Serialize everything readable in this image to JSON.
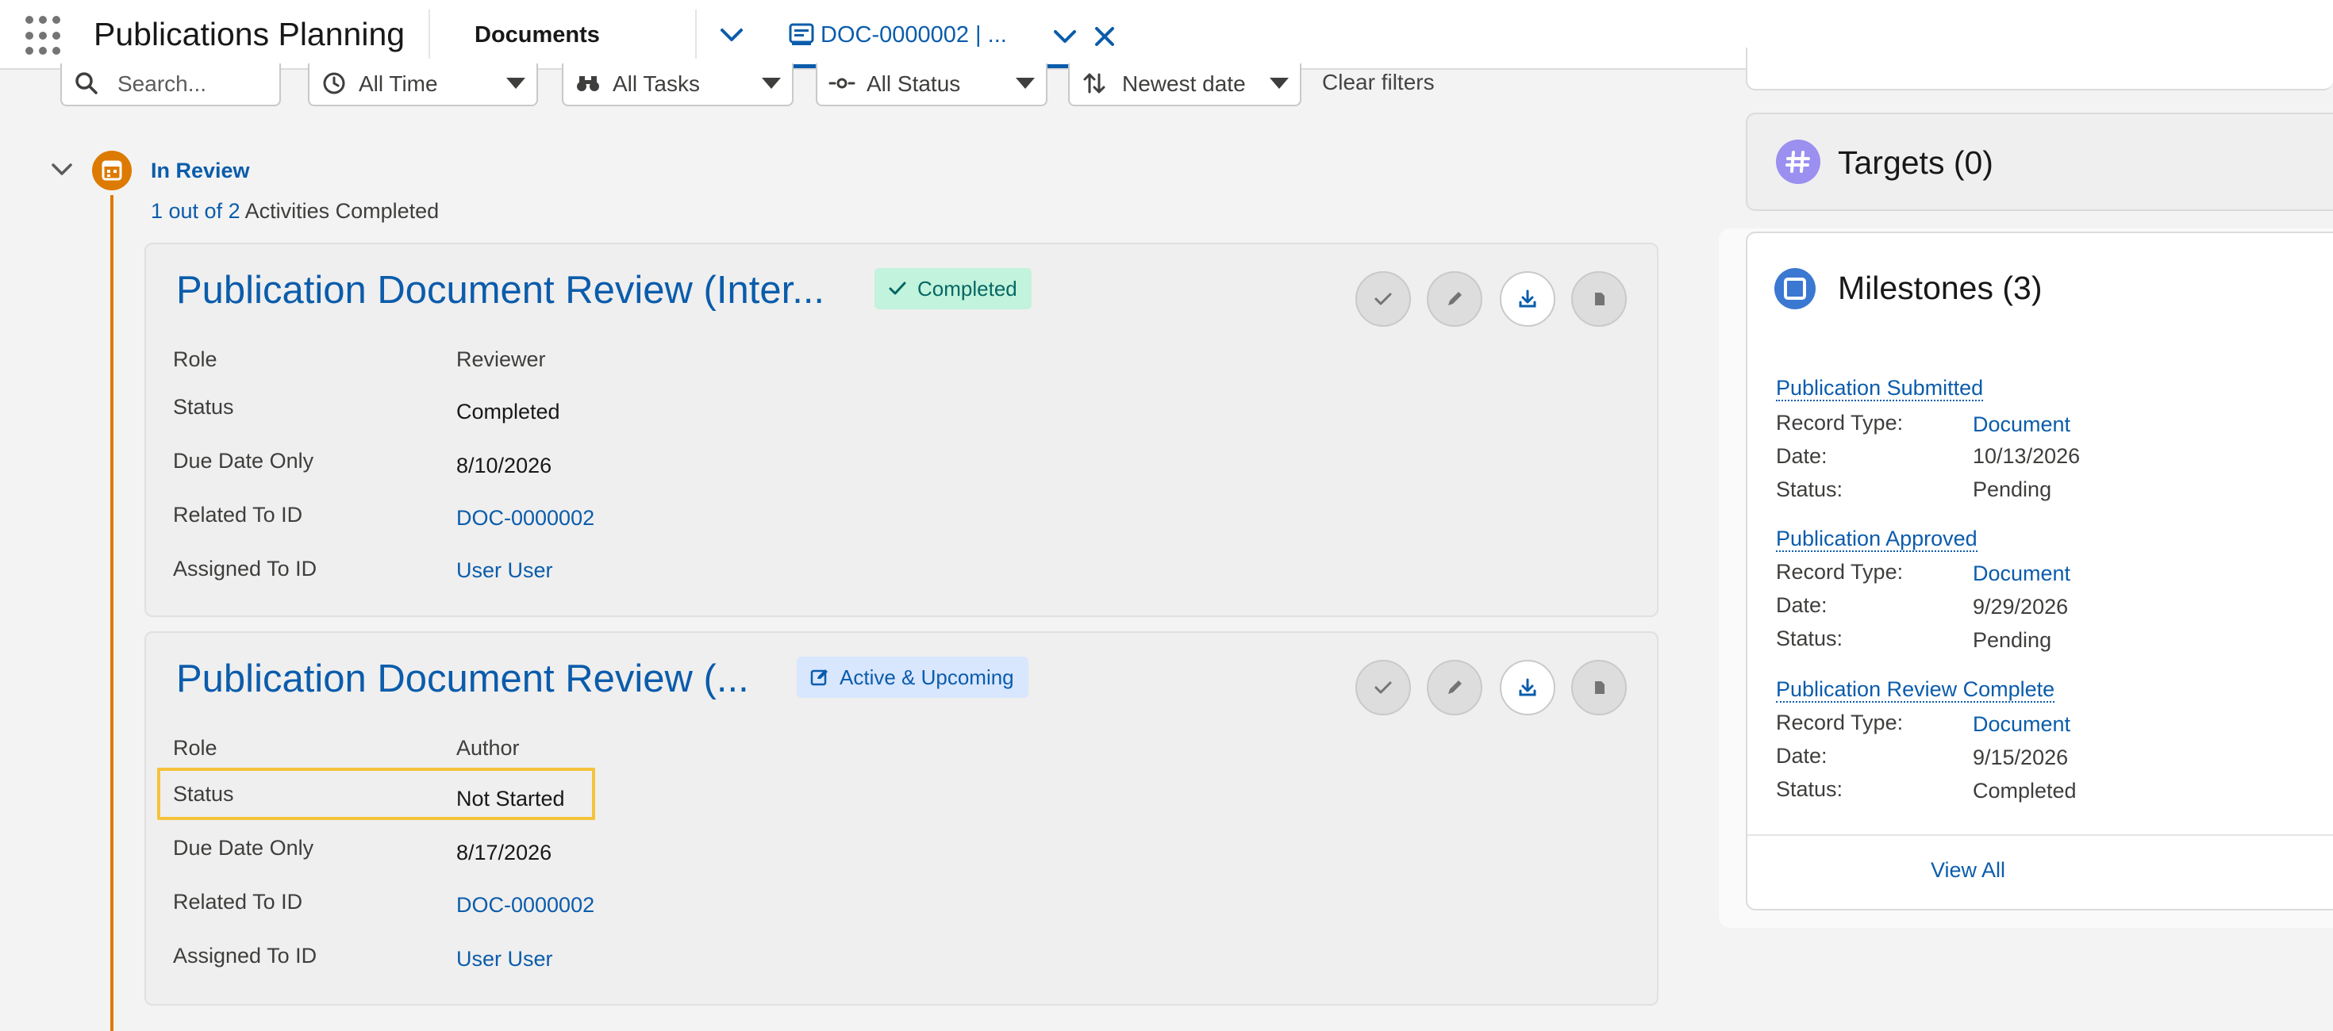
{
  "app": {
    "name": "Publications Planning",
    "nav_item": "Documents",
    "tab": {
      "label": "DOC-0000002 | ..."
    }
  },
  "filters": {
    "search_placeholder": "Search...",
    "time": "All Time",
    "tasks": "All Tasks",
    "status": "All Status",
    "sort": "Newest date",
    "clear": "Clear filters"
  },
  "group": {
    "title": "In Review",
    "progress_link": "1 out of 2",
    "progress_text": " Activities Completed"
  },
  "cards": [
    {
      "title": "Publication Document Review (Inter...",
      "badge": "Completed",
      "fields": [
        {
          "label": "Role",
          "value": "Reviewer"
        },
        {
          "label": "Status",
          "value": "Completed"
        },
        {
          "label": "Due Date Only",
          "value": "8/10/2026"
        },
        {
          "label": "Related To ID",
          "value": "DOC-0000002"
        },
        {
          "label": "Assigned To ID",
          "value": "User User"
        }
      ]
    },
    {
      "title": "Publication Document Review (...",
      "badge": "Active & Upcoming",
      "fields": [
        {
          "label": "Role",
          "value": "Author"
        },
        {
          "label": "Status",
          "value": "Not Started"
        },
        {
          "label": "Due Date Only",
          "value": "8/17/2026"
        },
        {
          "label": "Related To ID",
          "value": "DOC-0000002"
        },
        {
          "label": "Assigned To ID",
          "value": "User User"
        }
      ]
    }
  ],
  "targets": {
    "title": "Targets (0)"
  },
  "milestones": {
    "title": "Milestones (3)",
    "labels": {
      "record_type": "Record Type:",
      "date": "Date:",
      "status": "Status:"
    },
    "items": [
      {
        "name": "Publication Submitted",
        "record_type": "Document",
        "date": "10/13/2026",
        "status": "Pending"
      },
      {
        "name": "Publication Approved",
        "record_type": "Document",
        "date": "9/29/2026",
        "status": "Pending"
      },
      {
        "name": "Publication Review Complete",
        "record_type": "Document",
        "date": "9/15/2026",
        "status": "Completed"
      }
    ],
    "view_all": "View All"
  },
  "colors": {
    "brand_blue": "#0b5cab",
    "timeline_orange": "#dd7a01",
    "completed_badge_bg": "#c2f3dc",
    "active_badge_bg": "#d8e6fe",
    "highlight": "#f5c33b"
  }
}
